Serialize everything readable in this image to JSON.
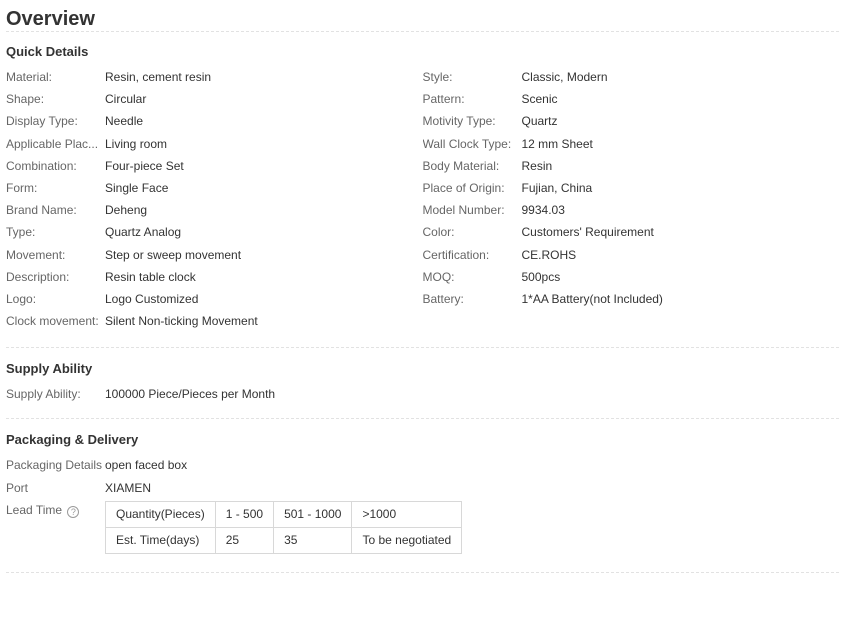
{
  "overview_title": "Overview",
  "quick_details": {
    "title": "Quick Details",
    "left": [
      {
        "label": "Material:",
        "value": "Resin, cement resin"
      },
      {
        "label": "Shape:",
        "value": "Circular"
      },
      {
        "label": "Display Type:",
        "value": "Needle"
      },
      {
        "label": "Applicable Plac...",
        "value": "Living room"
      },
      {
        "label": "Combination:",
        "value": "Four-piece Set"
      },
      {
        "label": "Form:",
        "value": "Single Face"
      },
      {
        "label": "Brand Name:",
        "value": "Deheng"
      },
      {
        "label": "Type:",
        "value": "Quartz Analog"
      },
      {
        "label": "Movement:",
        "value": "Step or sweep movement"
      },
      {
        "label": "Description:",
        "value": "Resin table clock"
      },
      {
        "label": "Logo:",
        "value": "Logo Customized"
      },
      {
        "label": "Clock movement:",
        "value": "Silent Non-ticking Movement"
      }
    ],
    "right": [
      {
        "label": "Style:",
        "value": "Classic, Modern"
      },
      {
        "label": "Pattern:",
        "value": "Scenic"
      },
      {
        "label": "Motivity Type:",
        "value": "Quartz"
      },
      {
        "label": "Wall Clock Type:",
        "value": "12 mm Sheet"
      },
      {
        "label": "Body Material:",
        "value": "Resin"
      },
      {
        "label": "Place of Origin:",
        "value": "Fujian, China"
      },
      {
        "label": "Model Number:",
        "value": "9934.03"
      },
      {
        "label": "Color:",
        "value": "Customers' Requirement"
      },
      {
        "label": "Certification:",
        "value": "CE.ROHS"
      },
      {
        "label": "MOQ:",
        "value": "500pcs"
      },
      {
        "label": "Battery:",
        "value": "1*AA Battery(not Included)"
      }
    ]
  },
  "supply_ability": {
    "title": "Supply Ability",
    "label": "Supply Ability:",
    "value": "100000 Piece/Pieces per Month"
  },
  "packaging": {
    "title": "Packaging & Delivery",
    "details_label": "Packaging Details",
    "details_value": "open faced box",
    "port_label": "Port",
    "port_value": "XIAMEN",
    "lead_time_label": "Lead Time",
    "help_icon": "question-circle-icon",
    "lead_table": [
      [
        "Quantity(Pieces)",
        "1 - 500",
        "501 - 1000",
        ">1000"
      ],
      [
        "Est. Time(days)",
        "25",
        "35",
        "To be negotiated"
      ]
    ]
  }
}
